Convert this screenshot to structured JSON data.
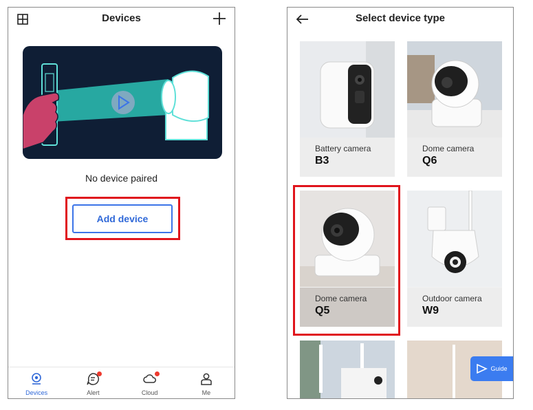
{
  "left_screen": {
    "header": {
      "title": "Devices"
    },
    "empty_state": {
      "text": "No device paired"
    },
    "add_device_label": "Add device",
    "tabs": [
      {
        "label": "Devices",
        "icon": "camera-icon",
        "active": true,
        "badge": false
      },
      {
        "label": "Alert",
        "icon": "message-icon",
        "active": false,
        "badge": true
      },
      {
        "label": "Cloud",
        "icon": "cloud-icon",
        "active": false,
        "badge": true
      },
      {
        "label": "Me",
        "icon": "person-icon",
        "active": false,
        "badge": false
      }
    ]
  },
  "right_screen": {
    "header": {
      "title": "Select device type"
    },
    "devices": [
      {
        "type": "Battery camera",
        "model": "B3"
      },
      {
        "type": "Dome camera",
        "model": "Q6"
      },
      {
        "type": "Dome camera",
        "model": "Q5"
      },
      {
        "type": "Outdoor camera",
        "model": "W9"
      }
    ],
    "guide_label": "Guide"
  },
  "colors": {
    "accent": "#3b74e8",
    "highlight": "#e0141c",
    "badge": "#ee3a2e",
    "illustration_bg": "#0f1e35"
  }
}
